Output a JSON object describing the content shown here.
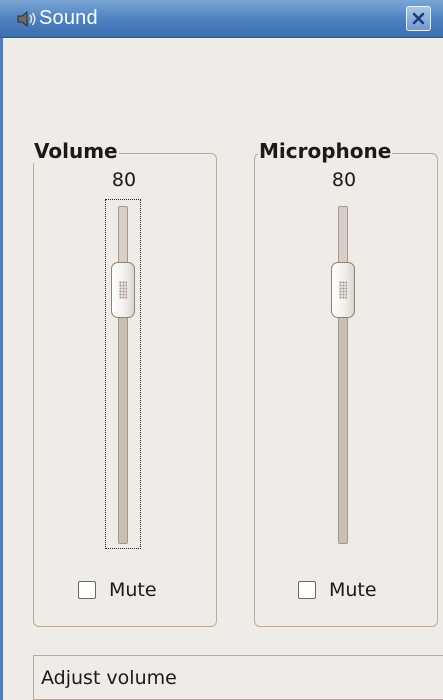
{
  "window": {
    "title": "Sound",
    "icon": "speaker-icon",
    "close_icon": "close-icon"
  },
  "volume": {
    "frame_title": "Volume",
    "level": "80",
    "level_fraction": 0.8,
    "mute_label": "Mute",
    "muted": false,
    "focused": true
  },
  "microphone": {
    "frame_title": "Microphone",
    "level": "80",
    "level_fraction": 0.8,
    "mute_label": "Mute",
    "muted": false,
    "focused": false
  },
  "status": {
    "text": "Adjust volume"
  },
  "colors": {
    "titlebar": "#4b7fbf",
    "background": "#efebe7"
  }
}
